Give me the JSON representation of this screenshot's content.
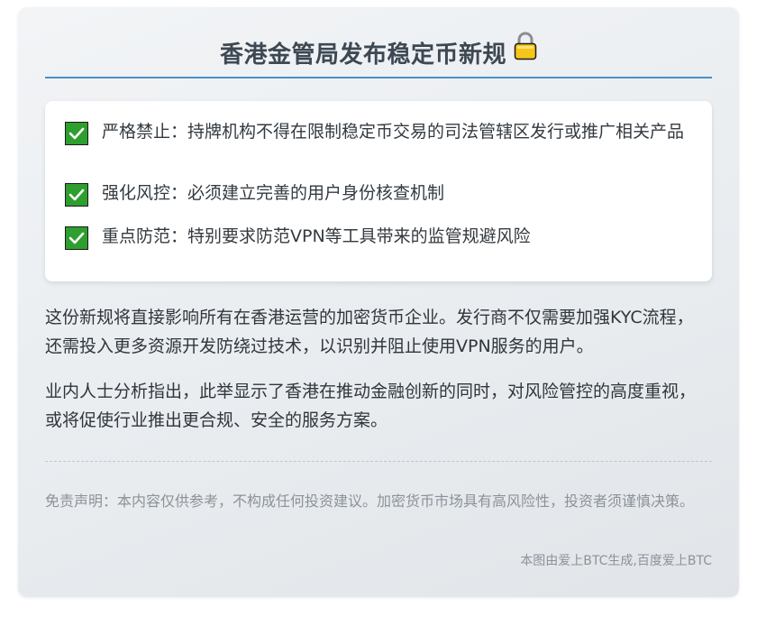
{
  "title": "香港金管局发布稳定币新规",
  "title_icon": "lock-icon",
  "rules": [
    {
      "text": "严格禁止：持牌机构不得在限制稳定币交易的司法管辖区发行或推广相关产品",
      "icon": "check-mark-icon"
    },
    {
      "text": "强化风控：必须建立完善的用户身份核查机制",
      "icon": "check-mark-icon"
    },
    {
      "text": "重点防范：特别要求防范VPN等工具带来的监管规避风险",
      "icon": "check-mark-icon"
    }
  ],
  "paragraphs": [
    "这份新规将直接影响所有在香港运营的加密货币企业。发行商不仅需要加强KYC流程，还需投入更多资源开发防绕过技术，以识别并阻止使用VPN服务的用户。",
    "业内人士分析指出，此举显示了香港在推动金融创新的同时，对风险管控的高度重视，或将促使行业推出更合规、安全的服务方案。"
  ],
  "disclaimer": "免责声明：本内容仅供参考，不构成任何投资建议。加密货币市场具有高风险性，投资者须谨慎决策。",
  "credit": "本图由爱上BTC生成,百度爱上BTC",
  "colors": {
    "accent_line": "#4a90c8",
    "check_green": "#2e9e2f",
    "lock_gold": "#f5c518"
  }
}
